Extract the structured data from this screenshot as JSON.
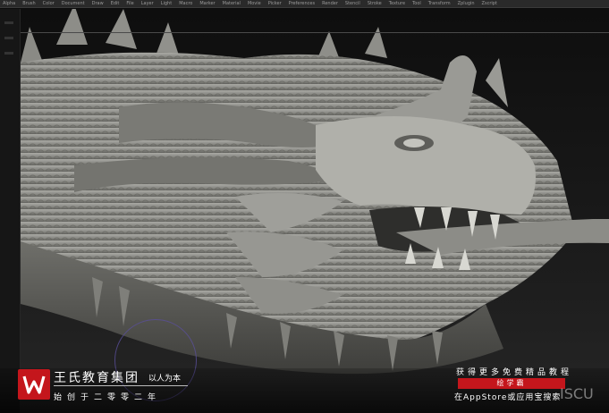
{
  "menubar": {
    "items": [
      "Alpha",
      "Brush",
      "Color",
      "Document",
      "Draw",
      "Edit",
      "File",
      "Layer",
      "Light",
      "Macro",
      "Marker",
      "Material",
      "Movie",
      "Picker",
      "Preferences",
      "Render",
      "Stencil",
      "Stroke",
      "Texture",
      "Tool",
      "Transform",
      "Zplugin",
      "Zscript"
    ]
  },
  "viewport": {
    "content": "dragon-sculpt"
  },
  "brand": {
    "name": "王氏教育集团",
    "slogan": "以人为本",
    "since": "始创于二零零二年",
    "logo_letter": "W",
    "logo_color": "#c4161c"
  },
  "promo": {
    "line1": "获得更多免费精品教程",
    "badge": "绘学霸",
    "line2": "在AppStore或应用宝搜索",
    "watermark": "ISCU"
  }
}
